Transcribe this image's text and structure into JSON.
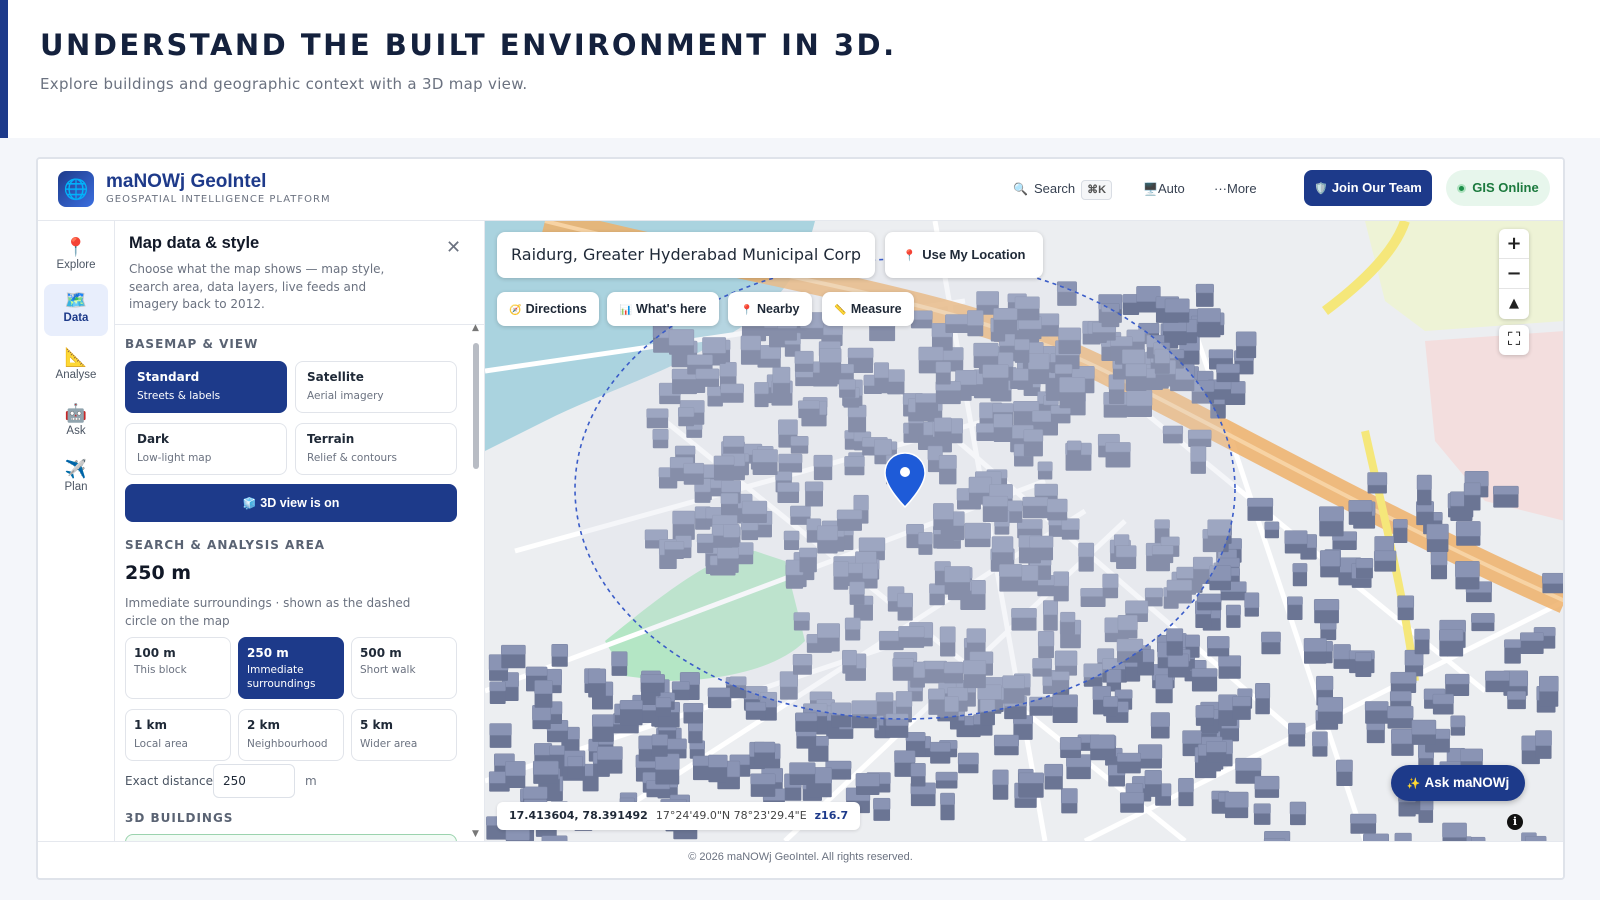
{
  "hero": {
    "title": "UNDERSTAND THE BUILT ENVIRONMENT IN 3D.",
    "subtitle": "Explore buildings and geographic context with a 3D map view."
  },
  "topbar": {
    "brand": "maNOWj GeoIntel",
    "tagline": "GEOSPATIAL INTELLIGENCE PLATFORM",
    "search_label": "Search",
    "search_shortcut": "⌘K",
    "theme_label": "Auto",
    "more_label": "···More",
    "join_label": "Join Our Team",
    "status_label": "GIS Online",
    "icons": {
      "logo": "globe-icon",
      "search": "search-icon",
      "theme": "monitor-icon",
      "join": "shield-icon"
    }
  },
  "rail": {
    "items": [
      {
        "label": "Explore",
        "icon": "📍",
        "active": false
      },
      {
        "label": "Data",
        "icon": "🗺️",
        "active": true
      },
      {
        "label": "Analyse",
        "icon": "📐",
        "active": false
      },
      {
        "label": "Ask",
        "icon": "🤖",
        "active": false
      },
      {
        "label": "Plan",
        "icon": "✈️",
        "active": false
      }
    ]
  },
  "panel": {
    "title": "Map data & style",
    "description": "Choose what the map shows — map style, search area, data layers, live feeds and imagery back to 2012.",
    "basemap_heading": "BASEMAP & VIEW",
    "basemaps": [
      {
        "title": "Standard",
        "subtitle": "Streets & labels",
        "selected": true
      },
      {
        "title": "Satellite",
        "subtitle": "Aerial imagery",
        "selected": false
      },
      {
        "title": "Dark",
        "subtitle": "Low-light map",
        "selected": false
      },
      {
        "title": "Terrain",
        "subtitle": "Relief & contours",
        "selected": false
      }
    ],
    "view_toggle_label": "3D view is on",
    "area_heading": "SEARCH & ANALYSIS AREA",
    "current_distance": "250 m",
    "distance_description": "Immediate surroundings · shown as the dashed circle on the map",
    "distances": [
      {
        "title": "100 m",
        "subtitle": "This block",
        "selected": false
      },
      {
        "title": "250 m",
        "subtitle": "Immediate surroundings",
        "selected": true
      },
      {
        "title": "500 m",
        "subtitle": "Short walk",
        "selected": false
      },
      {
        "title": "1 km",
        "subtitle": "Local area",
        "selected": false
      },
      {
        "title": "2 km",
        "subtitle": "Neighbourhood",
        "selected": false
      },
      {
        "title": "5 km",
        "subtitle": "Wider area",
        "selected": false
      }
    ],
    "exact_label": "Exact distance",
    "exact_value": "250",
    "exact_unit": "m",
    "buildings_heading": "3D BUILDINGS"
  },
  "map": {
    "search_value": "Raidurg, Greater Hyderabad Municipal Corpora",
    "my_location_label": "Use My Location",
    "chips": [
      {
        "label": "Directions",
        "icon": "🧭"
      },
      {
        "label": "What's here",
        "icon": "📊"
      },
      {
        "label": "Nearby",
        "icon": "📍"
      },
      {
        "label": "Measure",
        "icon": "📏"
      }
    ],
    "coords_decimal": "17.413604, 78.391492",
    "coords_dms": "17°24'49.0\"N 78°23'29.4\"E",
    "zoom_level": "z16.7",
    "ask_label": "Ask maNOWj",
    "colors": {
      "building": "#8a94b4",
      "water": "#aad3df",
      "park": "#b4e6c5",
      "highway": "#efb06a",
      "pin": "#1e5bd8"
    }
  },
  "footer": {
    "copyright": "© 2026 maNOWj GeoIntel. All rights reserved."
  }
}
